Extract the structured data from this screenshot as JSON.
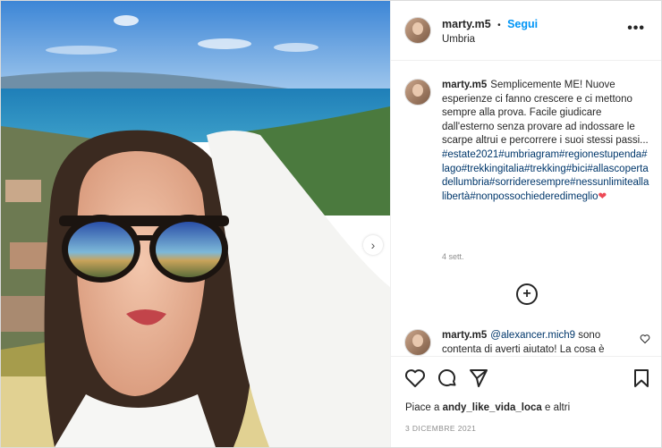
{
  "post": {
    "username": "marty.m5",
    "separator": "•",
    "follow_label": "Segui",
    "location": "Umbria",
    "more_label": "•••",
    "next_label": "›"
  },
  "caption": {
    "username": "marty.m5",
    "text": "Semplicemente ME! Nuove esperienze ci fanno crescere e ci mettono sempre alla prova. Facile giudicare dall'esterno senza provare ad indossare le scarpe altrui e percorrere i suoi stessi passi...",
    "hashtags": "#estate2021#umbriagram#regionestupenda#lago#trekkingitalia#trekking#bici#allascopertadellumbria#sorrideresempre#nessunlimitealla libertà#nonpossochiederedimeglio",
    "heart": "❤",
    "age": "4 sett."
  },
  "more_comments_label": "+",
  "comment": {
    "username": "marty.m5",
    "mention": "@alexancer.mich9",
    "text": "sono contenta di averti aiutato! La cosa è"
  },
  "likes": {
    "prefix": "Piace a",
    "user": "andy_like_vida_loca",
    "suffix": "e altri"
  },
  "date": "3 DICEMBRE 2021",
  "icons": [
    "heart-icon",
    "comment-icon",
    "share-icon",
    "bookmark-icon",
    "plus-circle-icon",
    "more-icon",
    "chevron-right-icon"
  ]
}
